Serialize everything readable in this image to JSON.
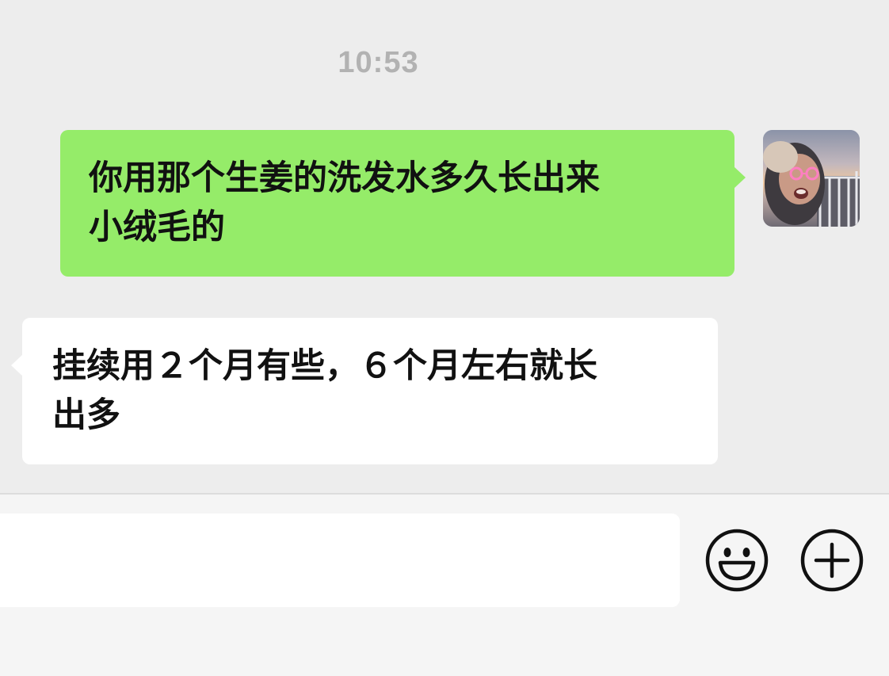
{
  "chat": {
    "timestamp": "10:53",
    "messages": [
      {
        "direction": "outgoing",
        "line1": "你用那个生姜的洗发水多久长出来",
        "line2": "小绒毛的"
      },
      {
        "direction": "incoming",
        "line1": "挂续用２个月有些，６个月左右就长",
        "line2": "出多"
      }
    ]
  },
  "input_bar": {
    "message_value": "",
    "emoji_icon": "smiley-face-icon",
    "more_icon": "plus-circle-icon"
  },
  "colors": {
    "chat_background": "#ededed",
    "outgoing_bubble": "#95ec69",
    "incoming_bubble": "#ffffff",
    "timestamp_text": "#b2b2b2",
    "input_bar_background": "#f5f5f5"
  }
}
